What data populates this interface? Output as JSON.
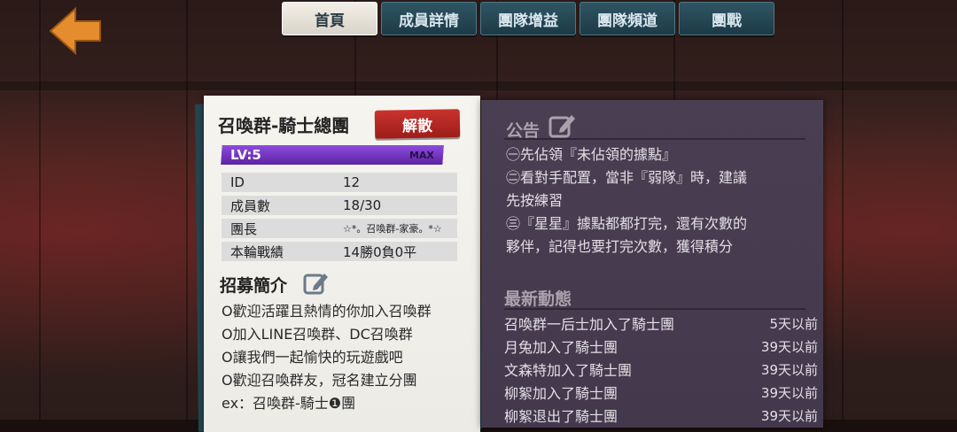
{
  "tabs": [
    {
      "label": "首頁",
      "active": true
    },
    {
      "label": "成員詳情",
      "active": false
    },
    {
      "label": "團隊增益",
      "active": false
    },
    {
      "label": "團隊頻道",
      "active": false
    },
    {
      "label": "團戰",
      "active": false
    }
  ],
  "team": {
    "name": "召喚群-騎士總團",
    "disband_label": "解散",
    "level_label": "LV:5",
    "level_max_label": "MAX",
    "level_progress": 1.0,
    "info": [
      {
        "key": "ID",
        "value": "12"
      },
      {
        "key": "成員數",
        "value": "18/30"
      },
      {
        "key": "團長",
        "value": "☆*。召喚群-家豪。*☆"
      },
      {
        "key": "本輪戰績",
        "value": "14勝0負0平"
      }
    ],
    "recruit_title": "招募簡介",
    "recruit_lines": [
      "O歡迎活躍且熱情的你加入召喚群",
      "O加入LINE召喚群、DC召喚群",
      "O讓我們一起愉快的玩遊戲吧",
      "O歡迎召喚群友，冠名建立分團",
      "ex：召喚群-騎士❶團"
    ]
  },
  "announcement": {
    "title": "公告",
    "lines": [
      "㊀先佔領『未佔領的據點』",
      "㊁看對手配置，當非『弱隊』時，建議",
      "先按練習",
      "㊂『星星』據點都都打完，還有次數的",
      "夥伴，記得也要打完次數，獲得積分"
    ]
  },
  "news": {
    "title": "最新動態",
    "items": [
      {
        "text": "召喚群一后士加入了騎士團",
        "time": "5天以前"
      },
      {
        "text": "月兔加入了騎士團",
        "time": "39天以前"
      },
      {
        "text": "文森特加入了騎士團",
        "time": "39天以前"
      },
      {
        "text": "柳絮加入了騎士團",
        "time": "39天以前"
      },
      {
        "text": "柳絮退出了騎士團",
        "time": "39天以前"
      }
    ]
  },
  "colors": {
    "tab_active": "#e8e4da",
    "tab_inactive": "#244450",
    "disband": "#b8282a",
    "level_bar": "#7a3cc6",
    "panel": "#463b4e"
  },
  "icons": [
    "back-arrow-icon",
    "edit-icon"
  ]
}
